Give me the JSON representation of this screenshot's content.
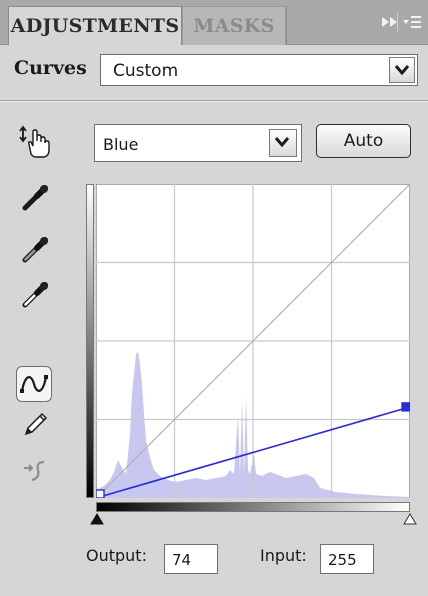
{
  "tabs": [
    {
      "label": "ADJUSTMENTS"
    },
    {
      "label": "MASKS"
    }
  ],
  "icons": {
    "collapse": "double-arrow-right-icon",
    "panel_menu": "panel-menu-icon",
    "target_adjust": "hand-target-adjust-icon",
    "black_point": "black-point-eyedropper-icon",
    "gray_point": "gray-point-eyedropper-icon",
    "white_point": "white-point-eyedropper-icon",
    "curve_tool": "curve-point-tool-icon",
    "pencil_tool": "pencil-draw-icon",
    "smooth": "smooth-curve-icon"
  },
  "preset": {
    "label": "Curves",
    "value": "Custom"
  },
  "channel": {
    "value": "Blue"
  },
  "auto_button": "Auto",
  "output": {
    "label": "Output:",
    "value": "74"
  },
  "input": {
    "label": "Input:",
    "value": "255"
  },
  "colors": {
    "curve": "#2b2bd6",
    "histogram": "#c7c7ef",
    "grid": "#c9c9c9",
    "diagonal": "#b5b5b5",
    "panel": "#d6d6d6"
  },
  "chart_data": {
    "type": "line",
    "curve_points": [
      {
        "x": 0,
        "y": 0
      },
      {
        "x": 255,
        "y": 74
      }
    ],
    "xlim": [
      0,
      255
    ],
    "ylim": [
      0,
      255
    ],
    "grid": true
  }
}
